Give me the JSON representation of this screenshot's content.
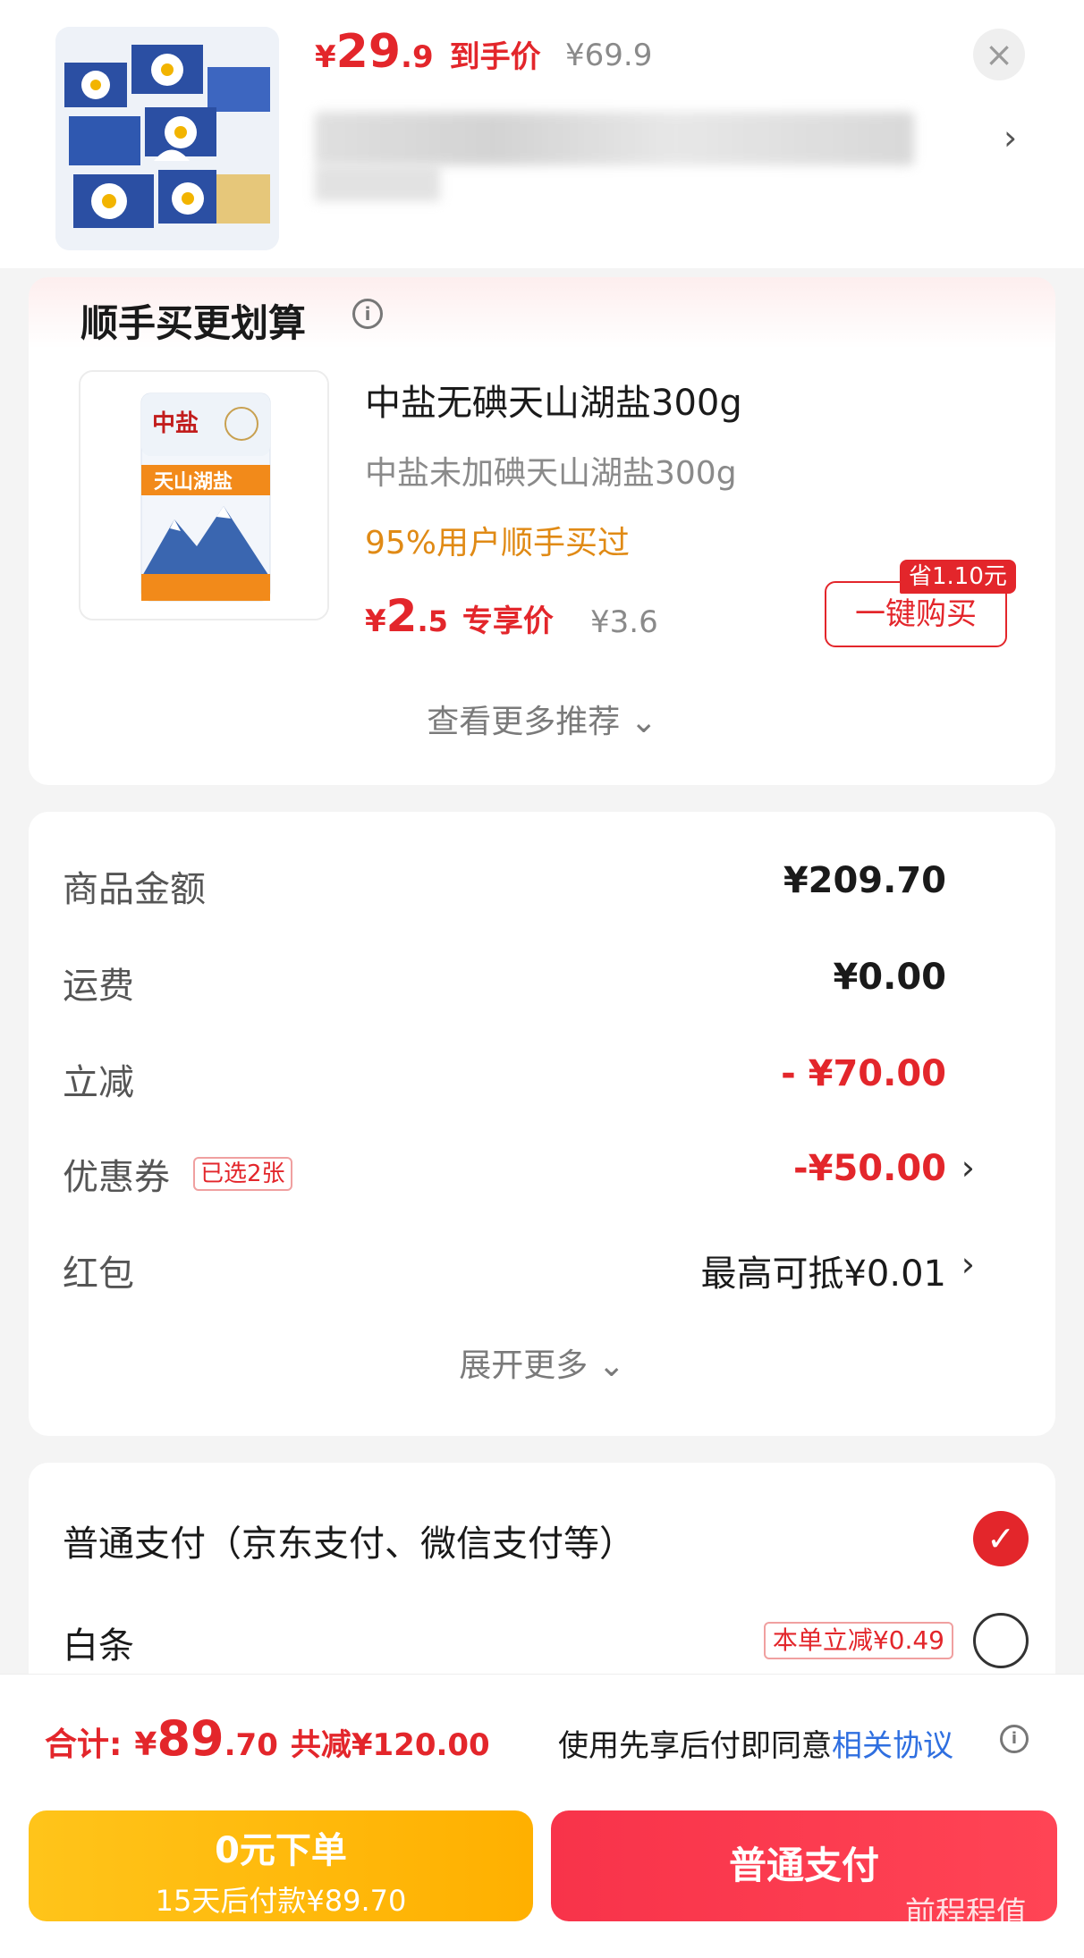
{
  "header": {
    "price_yen": "¥",
    "price_int": "29",
    "price_dec": ".9",
    "price_tag": "到手价",
    "orig_price": "¥69.9",
    "close_label": "×",
    "arrow": "›"
  },
  "recommend": {
    "title": "顺手买更划算",
    "info_icon": "i",
    "name": "中盐无碘天山湖盐300g",
    "sub": "中盐未加碘天山湖盐300g",
    "rate": "95%用户顺手买过",
    "price_yen": "¥",
    "price_int": "2",
    "price_dec": ".5",
    "price_tag": "专享价",
    "orig_price": "¥3.6",
    "save_badge": "省1.10元",
    "buy_label": "一键购买",
    "more_label": "查看更多推荐 ⌄"
  },
  "summary": {
    "rows": [
      {
        "label": "商品金额",
        "value": "¥209.70"
      },
      {
        "label": "运费",
        "value": "¥0.00"
      },
      {
        "label": "立减",
        "value": "- ¥70.00"
      },
      {
        "label": "优惠券",
        "chip": "已选2张",
        "value": "-¥50.00",
        "chev": "›"
      },
      {
        "label": "红包",
        "value": "最高可抵¥0.01",
        "chev": "›"
      }
    ],
    "expand_label": "展开更多 ⌄"
  },
  "payment": {
    "options": [
      {
        "label": "普通支付（京东支付、微信支付等）",
        "selected": true,
        "check": "✓"
      },
      {
        "label": "白条",
        "chip": "本单立减¥0.49",
        "selected": false
      }
    ]
  },
  "footer": {
    "total_label": "合计:",
    "total_yen": "¥",
    "total_int": "89",
    "total_dec": ".70",
    "total_save": "共减¥120.00",
    "agree_text": "使用先享后付即同意",
    "agree_link": "相关协议",
    "info_icon": "i",
    "left_btn_line1": "0元下单",
    "left_btn_line2": "15天后付款¥89.70",
    "right_btn": "普通支付"
  },
  "watermark": {
    "text": "前程程值",
    "url": "zhizhizhi.com"
  },
  "colors": {
    "accent_red": "#e3262b",
    "gold": "#ffb000",
    "link_blue": "#2f6fe0"
  }
}
